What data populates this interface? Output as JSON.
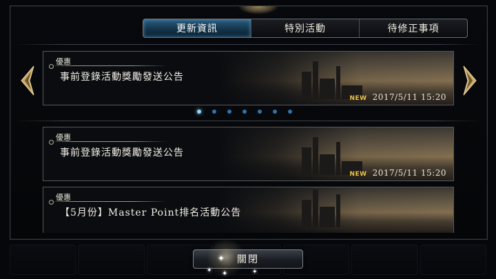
{
  "tabs": [
    {
      "label": "更新資訊",
      "active": true
    },
    {
      "label": "特別活動",
      "active": false
    },
    {
      "label": "待修正事項",
      "active": false
    }
  ],
  "carousel": {
    "slide_count": 7,
    "active_index": 0,
    "card": {
      "tag": "優惠",
      "title": "事前登錄活動獎勵發送公告",
      "new_label": "NEW",
      "date": "2017/5/11 15:20"
    }
  },
  "news": [
    {
      "tag": "優惠",
      "title": "事前登錄活動獎勵發送公告",
      "new_label": "NEW",
      "date": "2017/5/11 15:20"
    },
    {
      "tag": "優惠",
      "title": "【5月份】Master Point排名活動公告",
      "new_label": "",
      "date": ""
    }
  ],
  "close_button": {
    "label": "關閉"
  },
  "colors": {
    "active_tab": "#1d4a68",
    "new_badge": "#f0c34a",
    "dot": "#2f73b0",
    "dot_active": "#8fd3ff"
  }
}
